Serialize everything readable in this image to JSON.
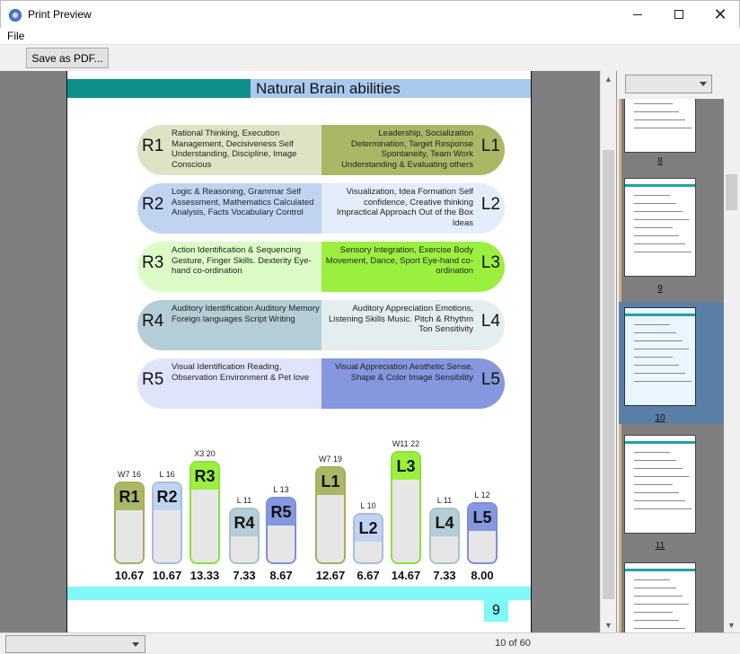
{
  "window": {
    "title": "Print Preview",
    "controls": {
      "minimize": "minimize",
      "maximize": "maximize",
      "close": "✕"
    }
  },
  "menu": {
    "file": "File"
  },
  "toolbar": {
    "save_pdf": "Save as PDF..."
  },
  "page": {
    "title": "Natural Brain abilities",
    "page_number": "9",
    "pills": [
      {
        "left_code": "R1",
        "left_text": "Rational Thinking, Execution Management, Decisiveness Self Understanding, Discipline, Image Conscious",
        "right_code": "L1",
        "right_text": "Leadership, Socialization Determination, Target Response Spontaneity, Team Work Understanding & Evaluating others",
        "left_color": "#dfe3c5",
        "right_color": "#acb766"
      },
      {
        "left_code": "R2",
        "left_text": "Logic & Reasoning, Grammar Self Assessment, Mathematics Calculated Analysis, Facts Vocabulary Control",
        "right_code": "L2",
        "right_text": "Visualization, Idea Formation Self confidence, Creative thinking Impractical Approach Out of the Box Ideas",
        "left_color": "#c0d4f2",
        "right_color": "#e4edfa"
      },
      {
        "left_code": "R3",
        "left_text": "Action Identification & Sequencing Gesture, Finger Skills. Dexterity Eye-hand co-ordination",
        "right_code": "L3",
        "right_text": "Sensory Integration, Exercise Body Movement, Dance, Sport Eye-hand co-ordination",
        "left_color": "#dcfbc6",
        "right_color": "#9bf03f"
      },
      {
        "left_code": "R4",
        "left_text": "Auditory Identification Auditory Memory Foreign languages Script Writing",
        "right_code": "L4",
        "right_text": "Auditory Appreciation Emotions, Listening Skills Music. Pitch & Rhythm Ton Sensitivity",
        "left_color": "#b4cdd6",
        "right_color": "#e4edf0"
      },
      {
        "left_code": "R5",
        "left_text": "Visual Identification Reading, Observation Environment & Pet love",
        "right_code": "L5",
        "right_text": "Visual Appreciation Aesthetic Sense, Shape & Color Image Sensibility",
        "left_color": "#e0e4fb",
        "right_color": "#8597df"
      }
    ]
  },
  "chart_data": {
    "type": "bar",
    "categories": [
      "R1",
      "R2",
      "R3",
      "R4",
      "R5",
      "L1",
      "L2",
      "L3",
      "L4",
      "L5"
    ],
    "values": [
      10.67,
      10.67,
      13.33,
      7.33,
      8.67,
      12.67,
      6.67,
      14.67,
      7.33,
      8.0
    ],
    "value_labels": [
      "10.67",
      "10.67",
      "13.33",
      "7.33",
      "8.67",
      "12.67",
      "6.67",
      "14.67",
      "7.33",
      "8.00"
    ],
    "top_labels": [
      "W7 16",
      "L 16",
      "X3 20",
      "L 11",
      "L 13",
      "W7 19",
      "L 10",
      "W11 22",
      "L 11",
      "L 12"
    ],
    "tag_colors": [
      "#acb766",
      "#c0d4f2",
      "#9bf03f",
      "#b4cdd6",
      "#8597df",
      "#acb766",
      "#c0d4f2",
      "#9bf03f",
      "#b4cdd6",
      "#8597df"
    ],
    "frame_colors": [
      "#a9ad5a",
      "#a6bde0",
      "#89e23a",
      "#a9c2cc",
      "#7d8fd8",
      "#a9ad5a",
      "#a6bde0",
      "#89e23a",
      "#a9c2cc",
      "#7d8fd8"
    ]
  },
  "thumbnails": [
    {
      "label": "8",
      "selected": false
    },
    {
      "label": "9",
      "selected": false
    },
    {
      "label": "10",
      "selected": true
    },
    {
      "label": "11",
      "selected": false
    }
  ],
  "status": {
    "page_indicator": "10 of 60",
    "zoom": ""
  }
}
